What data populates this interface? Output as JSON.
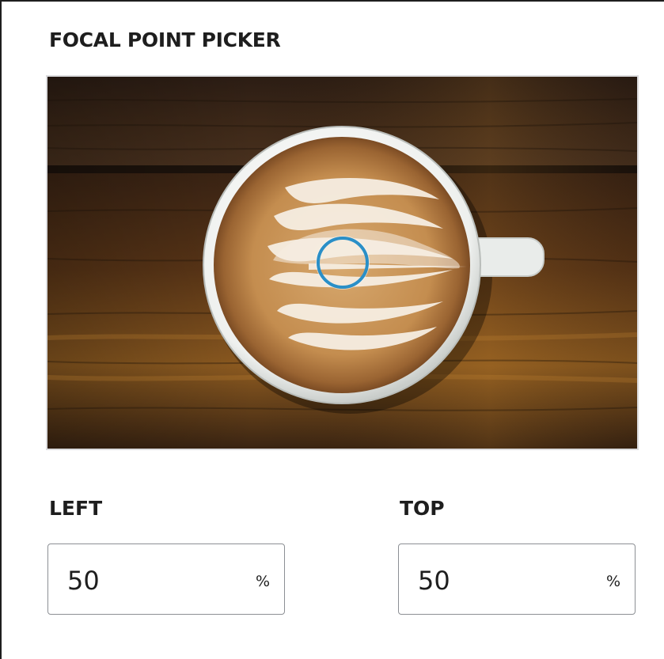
{
  "picker": {
    "title": "FOCAL POINT PICKER",
    "focal_point": {
      "left_percent": 50,
      "top_percent": 50
    }
  },
  "fields": {
    "left": {
      "label": "LEFT",
      "value": "50",
      "unit": "%"
    },
    "top": {
      "label": "TOP",
      "value": "50",
      "unit": "%"
    }
  },
  "colors": {
    "handle": "#2a8fc7",
    "text": "#1e1e1e",
    "field_border": "#8c8f94"
  }
}
